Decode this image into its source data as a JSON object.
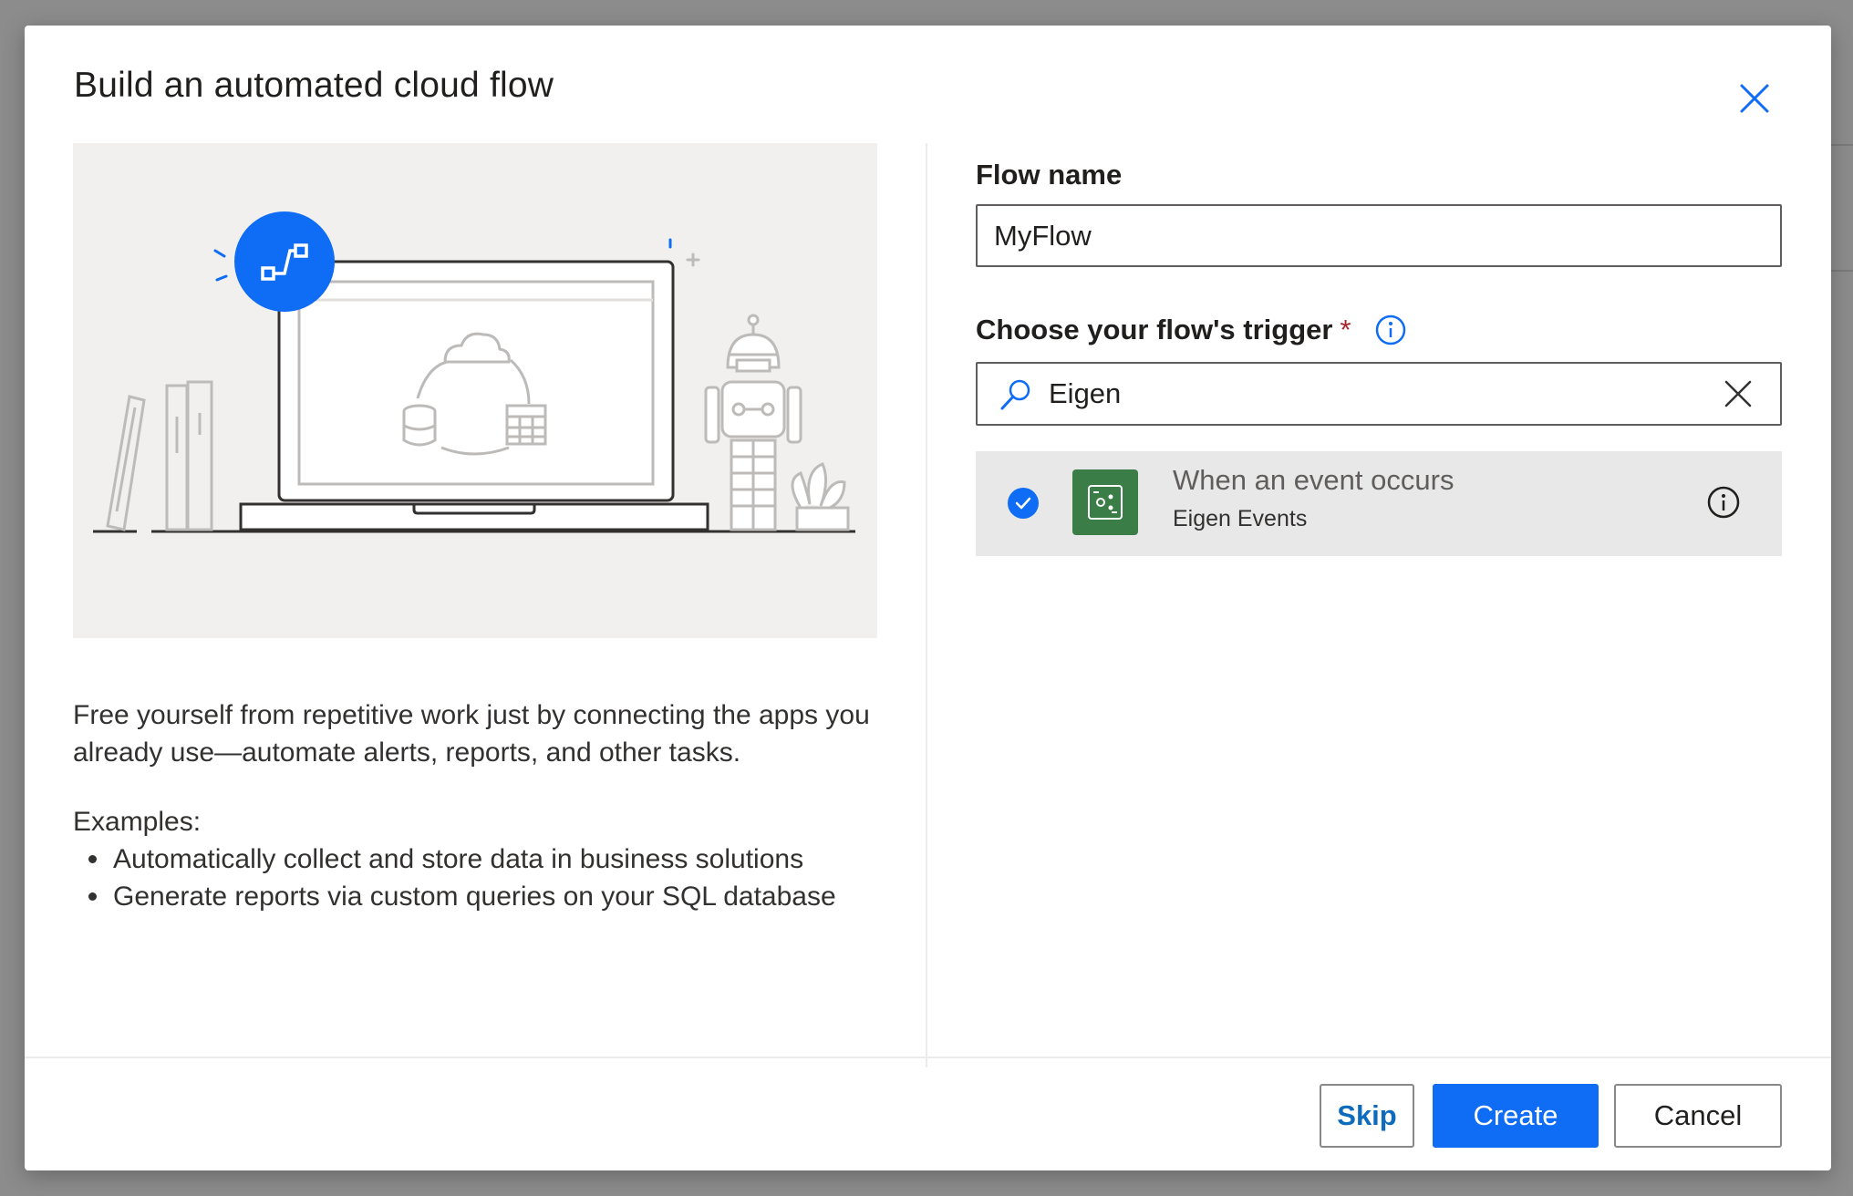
{
  "dialog": {
    "title": "Build an automated cloud flow"
  },
  "left": {
    "description": "Free yourself from repetitive work just by connecting the apps you already use—automate alerts, reports, and other tasks.",
    "examples_title": "Examples:",
    "examples": [
      "Automatically collect and store data in business solutions",
      "Generate reports via custom queries on your SQL database"
    ]
  },
  "form": {
    "flow_name_label": "Flow name",
    "flow_name_value": "MyFlow",
    "trigger_label": "Choose your flow's trigger",
    "required_mark": "*",
    "search_value": "Eigen"
  },
  "trigger_result": {
    "name": "When an event occurs",
    "connector": "Eigen Events",
    "selected": true,
    "tile_color": "#3b7d46"
  },
  "footer": {
    "skip_label": "Skip",
    "create_label": "Create",
    "cancel_label": "Cancel"
  },
  "colors": {
    "accent": "#0f6cf5",
    "hero_bg": "#f1f0ef"
  }
}
